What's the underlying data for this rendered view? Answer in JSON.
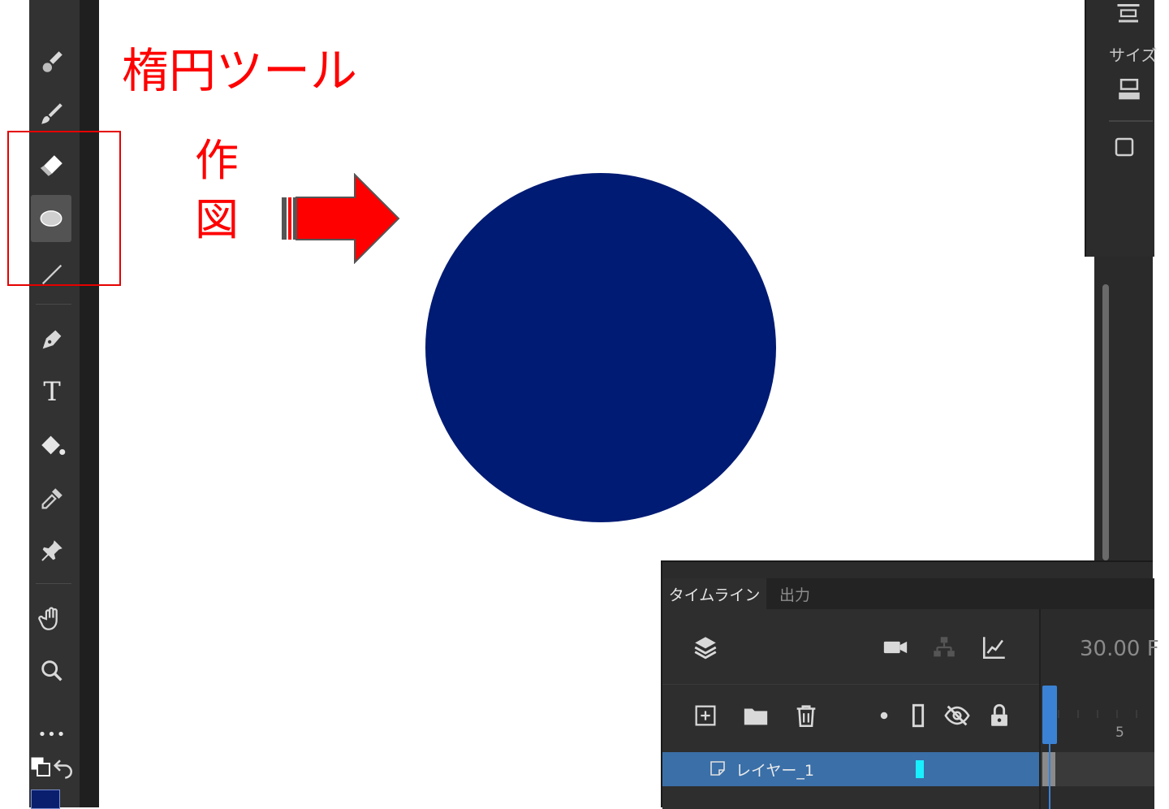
{
  "annotation": {
    "tool_name": "楕円ツール",
    "action_line1": "作",
    "action_line2": "図"
  },
  "toolbar": {
    "tools": [
      {
        "name": "paint-brush-icon"
      },
      {
        "name": "brush-icon"
      },
      {
        "name": "eraser-icon"
      },
      {
        "name": "oval-icon",
        "active": true
      },
      {
        "name": "line-icon"
      },
      {
        "name": "pen-icon"
      },
      {
        "name": "text-icon",
        "glyph": "T"
      },
      {
        "name": "paint-bucket-icon"
      },
      {
        "name": "eyedropper-icon"
      },
      {
        "name": "pin-icon"
      },
      {
        "name": "hand-icon"
      },
      {
        "name": "zoom-icon"
      },
      {
        "name": "more-tools-icon",
        "glyph": "•••"
      }
    ],
    "fill_color": "#001b73"
  },
  "right_panel": {
    "size_label": "サイズ"
  },
  "timeline": {
    "tabs": [
      {
        "label": "タイムライン",
        "active": true
      },
      {
        "label": "出力",
        "active": false
      }
    ],
    "fps": "30.00 F",
    "frame_marker": "5",
    "layer": {
      "name": "レイヤー_1",
      "color": "#19f0ff"
    }
  },
  "colors": {
    "accent": "#ff0000",
    "shape_fill": "#001b73",
    "panel_bg": "#2b2b2b",
    "selection": "#3a6fa8"
  }
}
